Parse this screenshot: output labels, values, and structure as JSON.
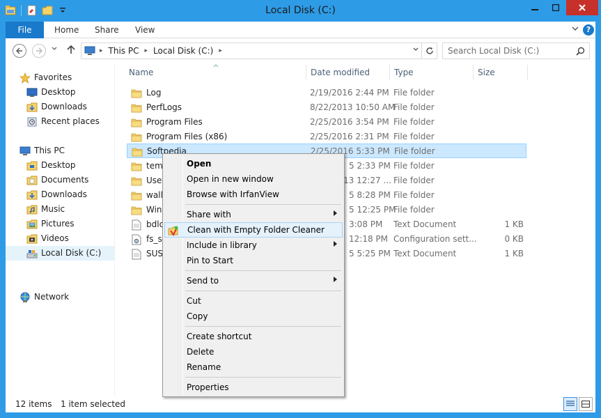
{
  "window": {
    "title": "Local Disk (C:)"
  },
  "ribbon": {
    "tabs": [
      "File",
      "Home",
      "Share",
      "View"
    ]
  },
  "address": {
    "crumbs": [
      "This PC",
      "Local Disk (C:)"
    ]
  },
  "search": {
    "placeholder": "Search Local Disk (C:)"
  },
  "navpane": {
    "favorites_label": "Favorites",
    "favorites": [
      "Desktop",
      "Downloads",
      "Recent places"
    ],
    "thispc_label": "This PC",
    "thispc": [
      "Desktop",
      "Documents",
      "Downloads",
      "Music",
      "Pictures",
      "Videos",
      "Local Disk (C:)"
    ],
    "network_label": "Network"
  },
  "columns": {
    "name": "Name",
    "date": "Date modified",
    "type": "Type",
    "size": "Size"
  },
  "files": [
    {
      "name": "Log",
      "date": "2/19/2016 2:44 PM",
      "type": "File folder",
      "size": "",
      "icon": "folder-icon"
    },
    {
      "name": "PerfLogs",
      "date": "8/22/2013 10:50 AM",
      "type": "File folder",
      "size": "",
      "icon": "folder-icon"
    },
    {
      "name": "Program Files",
      "date": "2/25/2016 3:54 PM",
      "type": "File folder",
      "size": "",
      "icon": "folder-icon"
    },
    {
      "name": "Program Files (x86)",
      "date": "2/25/2016 2:31 PM",
      "type": "File folder",
      "size": "",
      "icon": "folder-icon"
    },
    {
      "name": "Softpedia",
      "date": "2/25/2016 5:33 PM",
      "type": "File folder",
      "size": "",
      "icon": "folder-icon"
    },
    {
      "name": "temp",
      "date": "5 2:33 PM",
      "type": "File folder",
      "size": "",
      "icon": "folder-icon"
    },
    {
      "name": "Users",
      "date": "13 12:27 ...",
      "type": "File folder",
      "size": "",
      "icon": "folder-icon"
    },
    {
      "name": "wallp",
      "date": "5 8:28 PM",
      "type": "File folder",
      "size": "",
      "icon": "folder-icon"
    },
    {
      "name": "Wind",
      "date": "5 12:25 PM",
      "type": "File folder",
      "size": "",
      "icon": "folder-icon"
    },
    {
      "name": "bdlog",
      "date": "3:08 PM",
      "type": "Text Document",
      "size": "1 KB",
      "icon": "text-file-icon"
    },
    {
      "name": "fs_set",
      "date": "12:18 PM",
      "type": "Configuration sett...",
      "size": "0 KB",
      "icon": "config-file-icon"
    },
    {
      "name": "SUSe",
      "date": "5 5:25 PM",
      "type": "Text Document",
      "size": "1 KB",
      "icon": "text-file-icon"
    }
  ],
  "context_menu": {
    "items": [
      {
        "label": "Open",
        "bold": true
      },
      {
        "label": "Open in new window"
      },
      {
        "label": "Browse with IrfanView"
      },
      {
        "sep": true
      },
      {
        "label": "Share with",
        "sub": true
      },
      {
        "label": "Clean with Empty Folder Cleaner",
        "hover": true,
        "icon": "empty-folder-cleaner-icon"
      },
      {
        "label": "Include in library",
        "sub": true
      },
      {
        "label": "Pin to Start"
      },
      {
        "sep": true
      },
      {
        "label": "Send to",
        "sub": true
      },
      {
        "sep": true
      },
      {
        "label": "Cut"
      },
      {
        "label": "Copy"
      },
      {
        "sep": true
      },
      {
        "label": "Create shortcut"
      },
      {
        "label": "Delete"
      },
      {
        "label": "Rename"
      },
      {
        "sep": true
      },
      {
        "label": "Properties"
      }
    ]
  },
  "status": {
    "count": "12 items",
    "selected": "1 item selected"
  },
  "colors": {
    "titlebar": "#2e9be6",
    "file_tab": "#1979ca",
    "selection": "#cce8ff",
    "close": "#c7312b"
  }
}
